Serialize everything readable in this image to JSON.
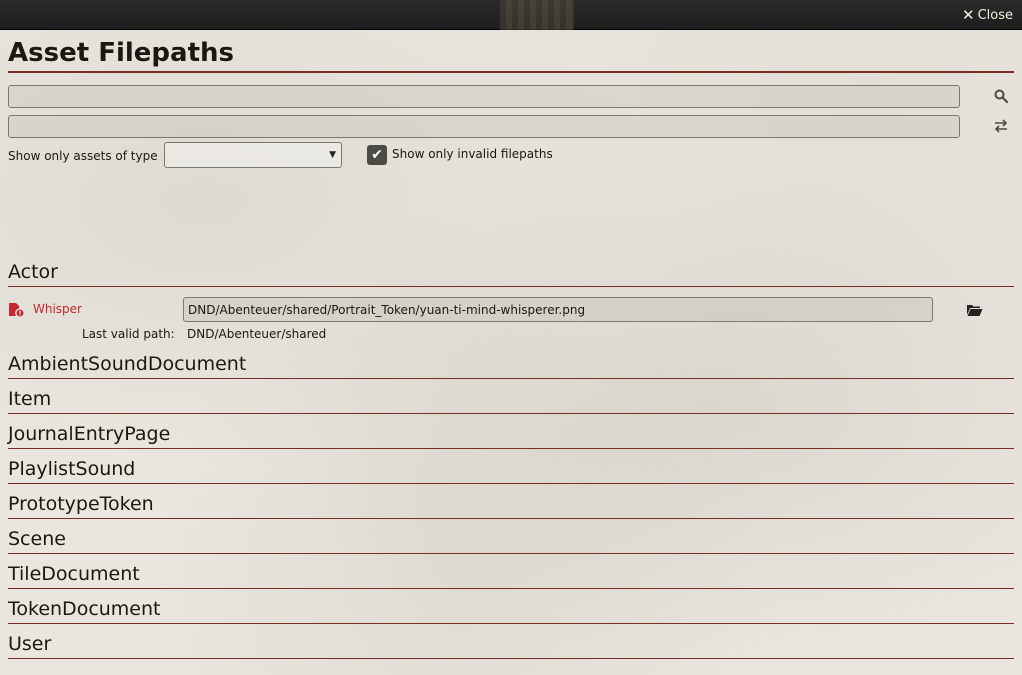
{
  "window": {
    "close_label": "Close"
  },
  "page": {
    "title": "Asset Filepaths"
  },
  "filters": {
    "type_label": "Show only assets of type",
    "type_selected": "",
    "invalid_only_label": "Show only invalid filepaths",
    "invalid_only_checked": true
  },
  "sections": [
    {
      "name": "Actor",
      "assets": [
        {
          "name": "Whisper",
          "path": "DND/Abenteuer/shared/Portrait_Token/yuan-ti-mind-whisperer.png",
          "last_valid_label": "Last valid path:",
          "last_valid_path": "DND/Abenteuer/shared"
        }
      ]
    },
    {
      "name": "AmbientSoundDocument"
    },
    {
      "name": "Item"
    },
    {
      "name": "JournalEntryPage"
    },
    {
      "name": "PlaylistSound"
    },
    {
      "name": "PrototypeToken"
    },
    {
      "name": "Scene"
    },
    {
      "name": "TileDocument"
    },
    {
      "name": "TokenDocument"
    },
    {
      "name": "User"
    }
  ],
  "icons": {
    "close": "close-icon",
    "search": "search-icon",
    "replace": "exchange-icon",
    "invalid_file": "file-error-icon",
    "browse": "folder-open-icon"
  },
  "colors": {
    "accent_rule": "#782e22",
    "error_text": "#c4282f"
  }
}
